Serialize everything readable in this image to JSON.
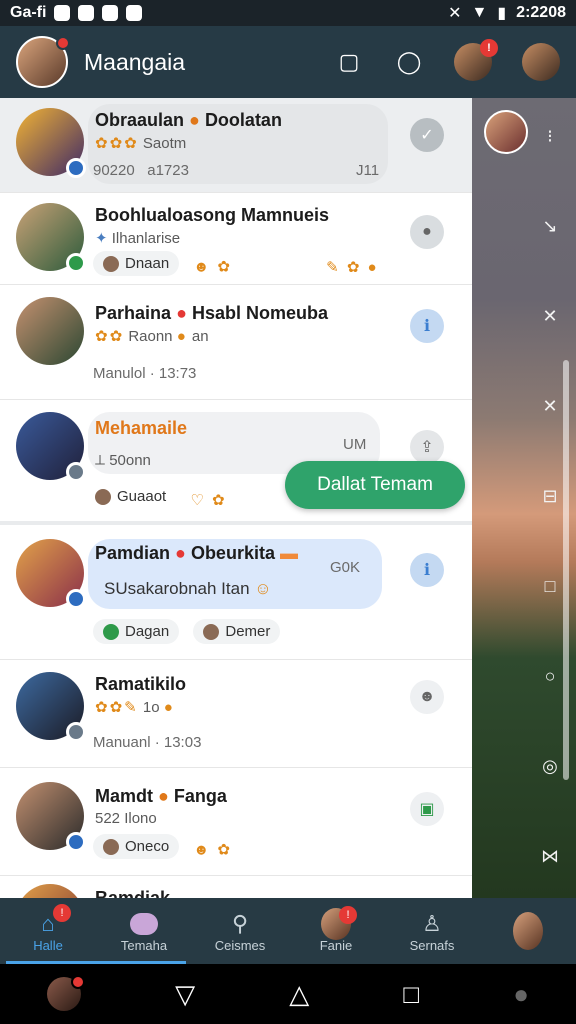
{
  "status_bar": {
    "left_text": "Ga-fi",
    "time": "2:2208"
  },
  "header": {
    "title": "Maangaia"
  },
  "chats": [
    {
      "name": "Obraaulan",
      "name_suffix": "Doolatan",
      "sub": "Saotm",
      "meta_a": "90220",
      "meta_b": "a1723",
      "meta_right": "J11"
    },
    {
      "name": "Boohlualoasong Mamnueis",
      "sub": "Ilhanlarise",
      "chip": "Dnaan"
    },
    {
      "name": "Parhaina",
      "name_suffix": "Hsabl Nomeuba",
      "sub": "Raonn",
      "sub_tail": "an",
      "meta": "Manulol · 13:73"
    },
    {
      "name": "Mehamaile",
      "sub": "50onn",
      "meta_right": "UM",
      "chip": "Guaaot"
    },
    {
      "name": "Pamdian",
      "name_suffix": "Obeurkita",
      "sub": "SUsakarobnah Itan",
      "meta_right": "G0K",
      "chips": [
        "Dagan",
        "Demer"
      ]
    },
    {
      "name": "Ramatikilo",
      "sub": "1o",
      "meta": "Manuanl · 13:03"
    },
    {
      "name": "Mamdt",
      "name_suffix": "Fanga",
      "sub": "522 Ilono",
      "chip": "Oneco"
    },
    {
      "name": "Bamdiak"
    }
  ],
  "float_button": {
    "label": "Dallat Temam"
  },
  "bottom_nav": [
    {
      "label": "Halle",
      "icon": "home-icon",
      "active": true
    },
    {
      "label": "Temaha",
      "icon": "chat-bubble-icon"
    },
    {
      "label": "Ceismes",
      "icon": "search-tool-icon"
    },
    {
      "label": "Fanie",
      "icon": "avatar-icon"
    },
    {
      "label": "Sernafs",
      "icon": "person-icon"
    },
    {
      "label": "",
      "icon": "profile-avatar"
    }
  ],
  "colors": {
    "header_bg": "#263a45",
    "accent_green": "#2fa36b",
    "active_blue": "#4aa3e8",
    "badge_red": "#e53935"
  }
}
